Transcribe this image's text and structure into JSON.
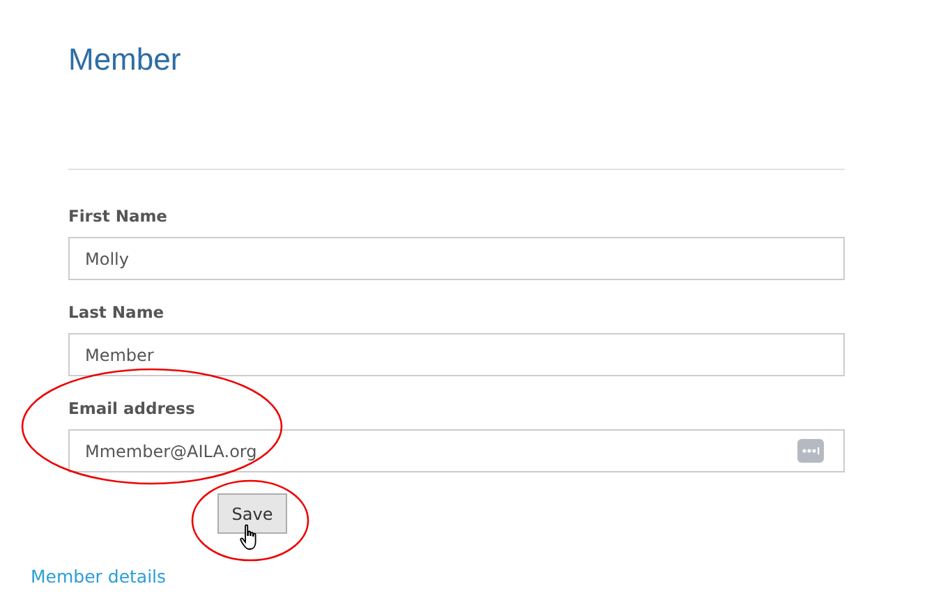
{
  "title": "Member",
  "fields": [
    {
      "label": "First Name",
      "value": "Molly",
      "kind": "plain",
      "circled": false
    },
    {
      "label": "Last Name",
      "value": "Member",
      "kind": "plain",
      "circled": false
    },
    {
      "label": "Email address",
      "value": "Mmember@AILA.org",
      "kind": "with-icon",
      "circled": true
    }
  ],
  "save_button": {
    "label": "Save",
    "circled": true,
    "hovered": true
  },
  "link": "Member details"
}
